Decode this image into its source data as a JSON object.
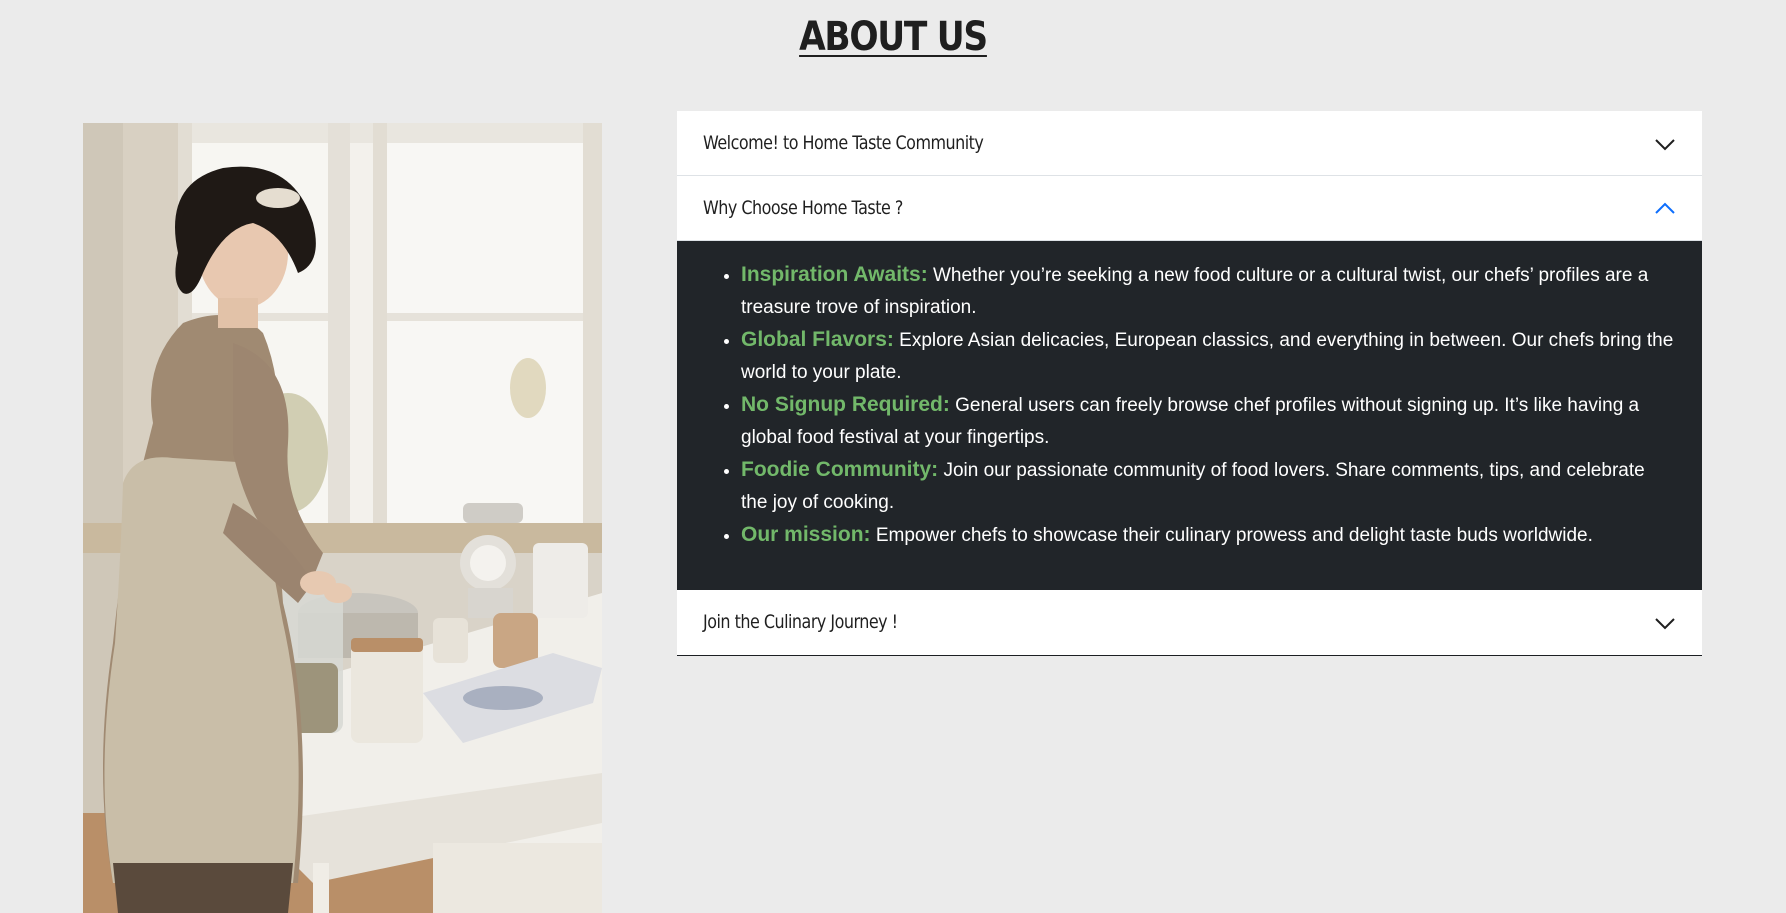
{
  "page": {
    "title": "ABOUT US"
  },
  "accordion": {
    "items": [
      {
        "label": "Welcome! to Home Taste Community",
        "expanded": false,
        "icon": "chevron-down-icon"
      },
      {
        "label": "Why Choose Home Taste ?",
        "expanded": true,
        "icon": "chevron-up-icon",
        "points": [
          {
            "term": "Inspiration Awaits:",
            "text": "Whether you’re seeking a new food culture or a cultural twist, our chefs’ profiles are a treasure trove of inspiration."
          },
          {
            "term": "Global Flavors:",
            "text": "Explore Asian delicacies, European classics, and everything in between. Our chefs bring the world to your plate."
          },
          {
            "term": "No Signup Required:",
            "text": "General users can freely browse chef profiles without signing up. It’s like having a global food festival at your fingertips."
          },
          {
            "term": "Foodie Community:",
            "text": "Join our passionate community of food lovers. Share comments, tips, and celebrate the joy of cooking."
          },
          {
            "term": "Our mission:",
            "text": "Empower chefs to showcase their culinary prowess and delight taste buds worldwide."
          }
        ]
      },
      {
        "label": "Join the Culinary Journey !",
        "expanded": false,
        "icon": "chevron-down-icon"
      }
    ]
  },
  "colors": {
    "background": "#ebebeb",
    "panel_dark": "#212529",
    "term_green": "#72b86a",
    "active_chevron": "#0d6efd"
  }
}
